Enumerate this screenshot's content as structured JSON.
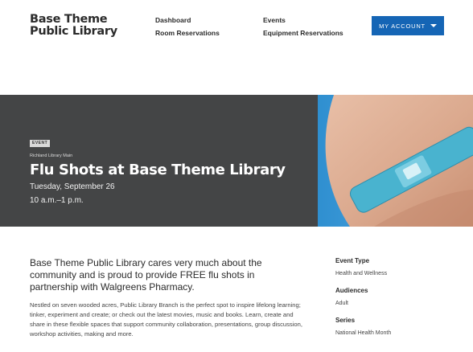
{
  "header": {
    "logo_line1": "Base Theme",
    "logo_line2": "Public Library",
    "nav_col1": [
      "Dashboard",
      "Room Reservations"
    ],
    "nav_col2": [
      "Events",
      "Equipment Reservations"
    ],
    "account_label": "MY ACCOUNT",
    "account_color": "#1565b5"
  },
  "hero": {
    "badge": "EVENT",
    "branch": "Richland Library Main",
    "title": "Flu Shots at Base Theme Library",
    "date": "Tuesday, September 26",
    "time": "10 a.m.–1 p.m.",
    "background": "#444546",
    "image_icon": "bandage-photo"
  },
  "main": {
    "lead": "Base Theme Public Library cares very much about the community and is proud to provide FREE flu shots in partnership with Walgreens Pharmacy.",
    "body": "Nestled on seven wooded acres, Public Library Branch is the perfect spot to inspire lifelong learning; tinker, experiment and create; or check out the latest movies, music and books. Learn, create and share in these flexible spaces that support community collaboration, presentations, group discussion, workshop activities, making and more."
  },
  "sidebar": [
    {
      "heading": "Event Type",
      "value": "Health and Wellness"
    },
    {
      "heading": "Audiences",
      "value": "Adult"
    },
    {
      "heading": "Series",
      "value": "National Health Month"
    }
  ]
}
